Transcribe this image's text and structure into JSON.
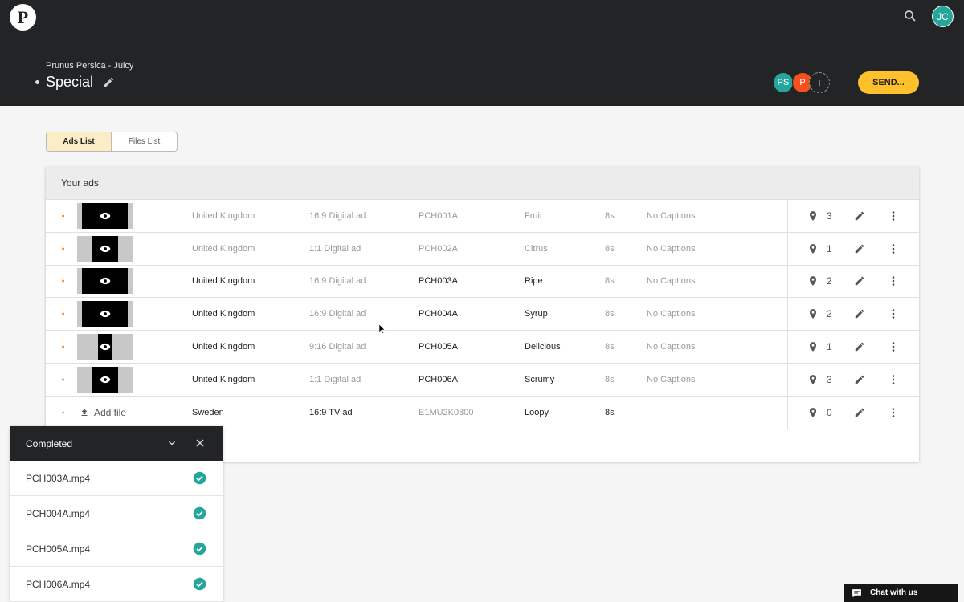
{
  "header": {
    "logo_letter": "P",
    "user_initials": "JC",
    "breadcrumb": "Prunus Persica - Juicy",
    "title": "Special",
    "collaborators": [
      "PS",
      "P"
    ],
    "add_collaborator": "+",
    "send_label": "SEND..."
  },
  "tabs": {
    "ads": "Ads List",
    "files": "Files List"
  },
  "ads": {
    "heading": "Your ads",
    "rows": [
      {
        "country": "United Kingdom",
        "format": "16:9 Digital ad",
        "code": "PCH001A",
        "name": "Fruit",
        "duration": "8s",
        "captions": "No Captions",
        "locations": "3"
      },
      {
        "country": "United Kingdom",
        "format": "1:1 Digital ad",
        "code": "PCH002A",
        "name": "Citrus",
        "duration": "8s",
        "captions": "No Captions",
        "locations": "1"
      },
      {
        "country": "United Kingdom",
        "format": "16:9 Digital ad",
        "code": "PCH003A",
        "name": "Ripe",
        "duration": "8s",
        "captions": "No Captions",
        "locations": "2"
      },
      {
        "country": "United Kingdom",
        "format": "16:9 Digital ad",
        "code": "PCH004A",
        "name": "Syrup",
        "duration": "8s",
        "captions": "No Captions",
        "locations": "2"
      },
      {
        "country": "United Kingdom",
        "format": "9:16 Digital ad",
        "code": "PCH005A",
        "name": "Delicious",
        "duration": "8s",
        "captions": "No Captions",
        "locations": "1"
      },
      {
        "country": "United Kingdom",
        "format": "1:1 Digital ad",
        "code": "PCH006A",
        "name": "Scrumy",
        "duration": "8s",
        "captions": "No Captions",
        "locations": "3"
      },
      {
        "add_file": "Add file",
        "country": "Sweden",
        "format": "16:9 TV ad",
        "code": "E1MU2K0800",
        "name": "Loopy",
        "duration": "8s",
        "captions": "",
        "locations": "0"
      }
    ]
  },
  "completed": {
    "title": "Completed",
    "files": [
      "PCH003A.mp4",
      "PCH004A.mp4",
      "PCH005A.mp4",
      "PCH006A.mp4"
    ]
  },
  "chat": {
    "label": "Chat with us"
  },
  "colors": {
    "accent": "#ffc02b",
    "header_bg": "#232425",
    "success": "#26a69a",
    "status_dot": "#f08a3c"
  }
}
